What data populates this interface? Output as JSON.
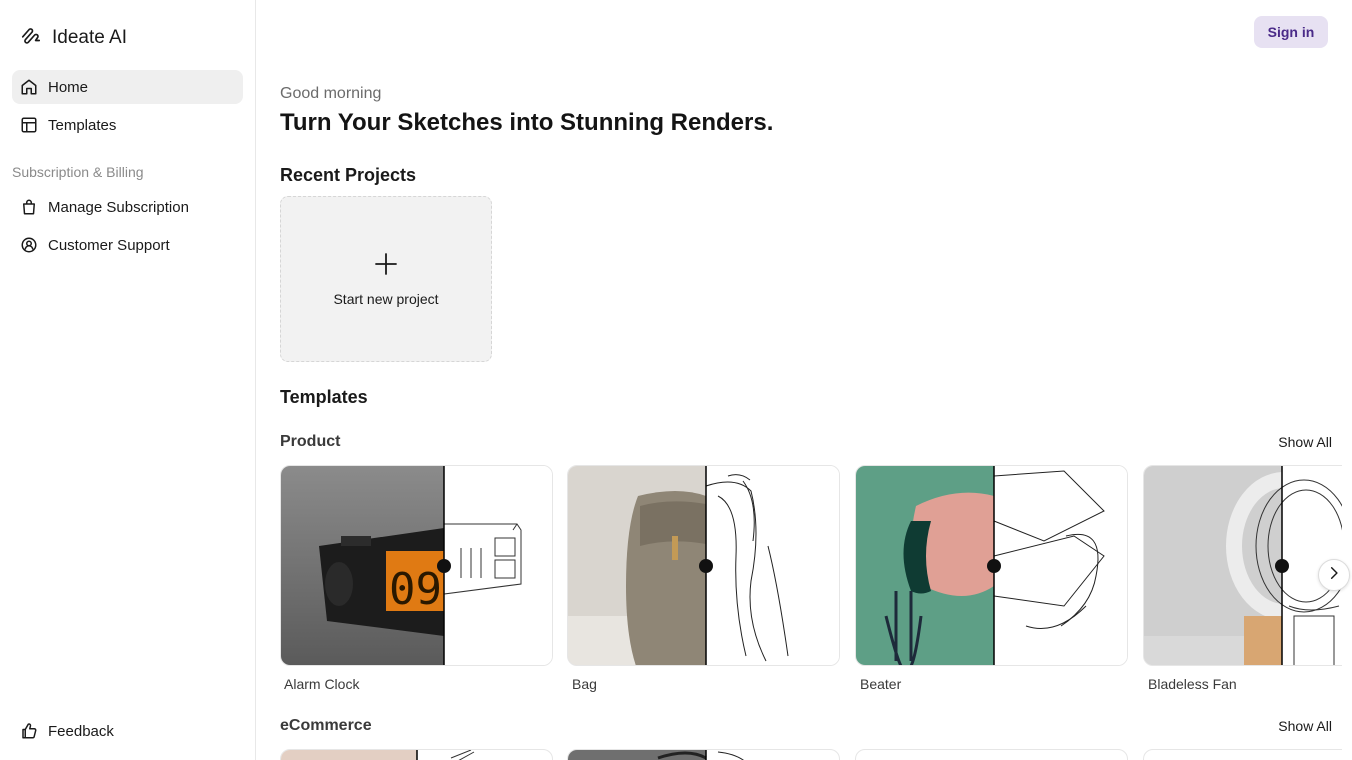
{
  "app": {
    "brand_name": "Ideate AI",
    "brand_icon": "pen-scribble-icon"
  },
  "sidebar": {
    "items": [
      {
        "label": "Home",
        "icon": "home-icon",
        "active": true
      },
      {
        "label": "Templates",
        "icon": "templates-icon",
        "active": false
      }
    ],
    "billing_section_label": "Subscription & Billing",
    "billing_items": [
      {
        "label": "Manage Subscription",
        "icon": "bag-icon"
      },
      {
        "label": "Customer Support",
        "icon": "support-icon"
      }
    ],
    "feedback_label": "Feedback",
    "feedback_icon": "thumbs-up-icon"
  },
  "header": {
    "signin_label": "Sign in",
    "signin_bg": "#e7e1f2",
    "signin_color": "#4a2a88"
  },
  "main": {
    "greeting": "Good morning",
    "headline": "Turn Your Sketches into Stunning Renders.",
    "recent_projects_title": "Recent Projects",
    "new_project_label": "Start new project",
    "templates_title": "Templates",
    "categories": [
      {
        "name": "Product",
        "show_all": "Show All",
        "items": [
          {
            "title": "Alarm Clock"
          },
          {
            "title": "Bag"
          },
          {
            "title": "Beater"
          },
          {
            "title": "Bladeless Fan"
          }
        ]
      },
      {
        "name": "eCommerce",
        "show_all": "Show All"
      }
    ]
  }
}
